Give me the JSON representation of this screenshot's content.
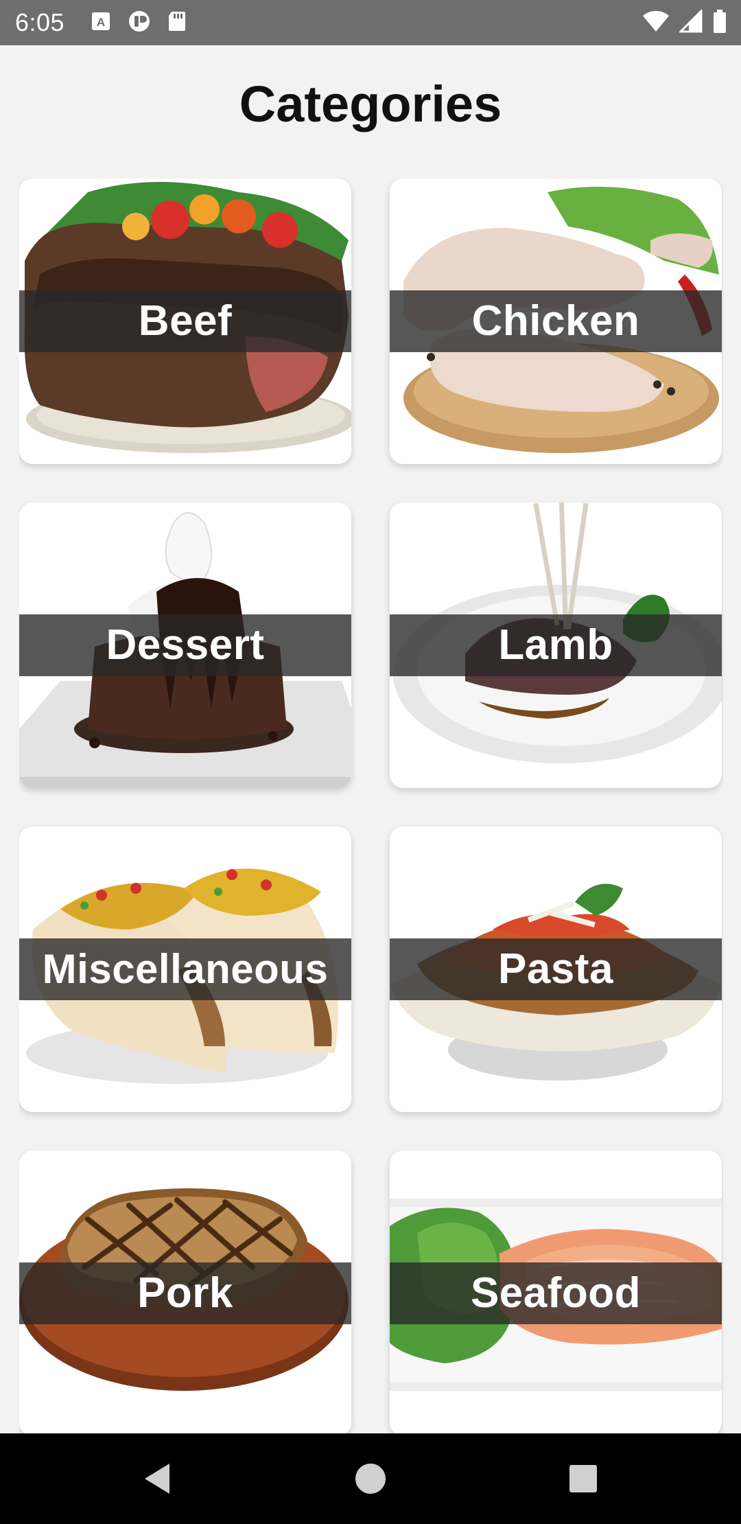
{
  "status_bar": {
    "time": "6:05",
    "left_icons": [
      "a-font-icon",
      "pocket-icon",
      "sd-card-icon"
    ],
    "right_icons": [
      "wifi-icon",
      "signal-icon",
      "battery-icon"
    ]
  },
  "page": {
    "title": "Categories"
  },
  "categories": [
    {
      "label": "Beef"
    },
    {
      "label": "Chicken"
    },
    {
      "label": "Dessert"
    },
    {
      "label": "Lamb"
    },
    {
      "label": "Miscellaneous"
    },
    {
      "label": "Pasta"
    },
    {
      "label": "Pork"
    },
    {
      "label": "Seafood"
    }
  ],
  "nav_bar": {
    "buttons": [
      "back-icon",
      "home-icon",
      "recents-icon"
    ]
  },
  "colors": {
    "status_bar": "#6e6e6e",
    "background": "#f2f2f2",
    "label_overlay": "#282828",
    "nav_bar": "#000000"
  }
}
